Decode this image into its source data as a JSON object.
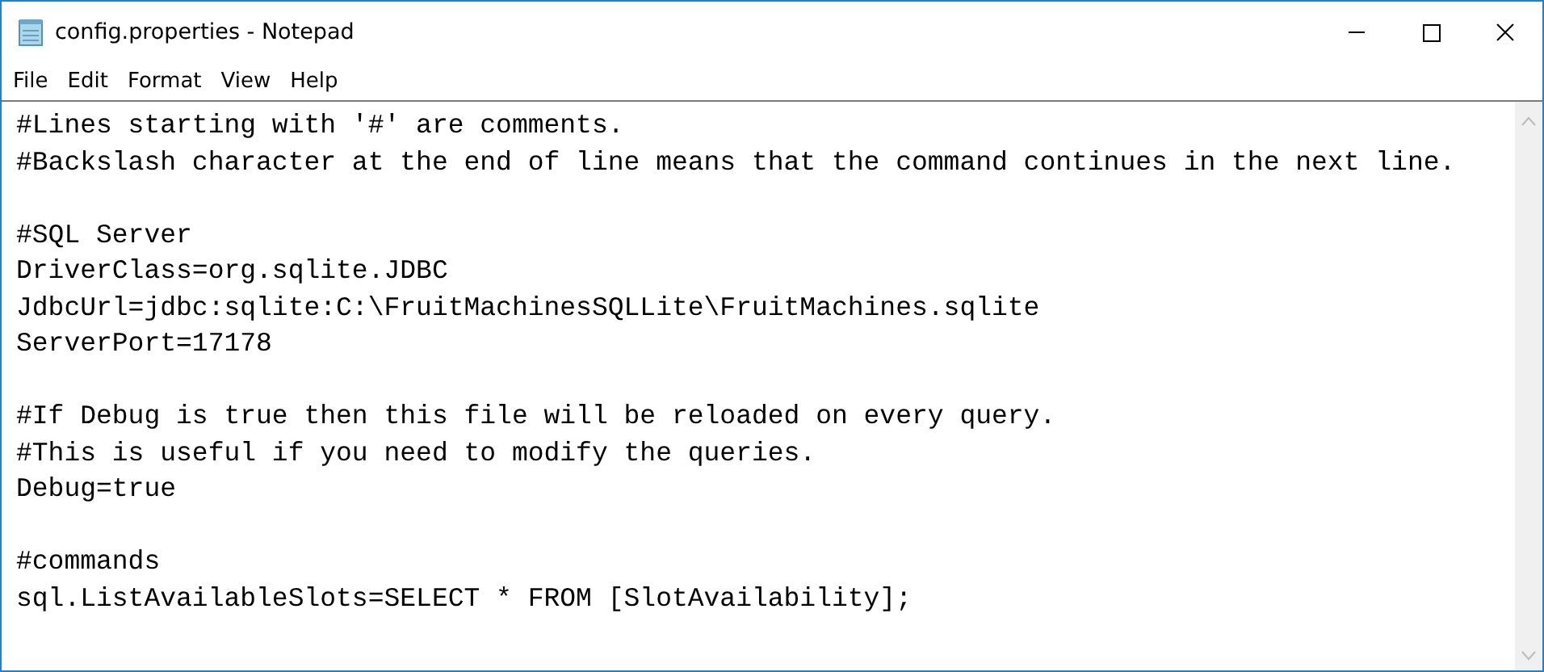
{
  "window": {
    "title": "config.properties - Notepad"
  },
  "menu": [
    "File",
    "Edit",
    "Format",
    "View",
    "Help"
  ],
  "editor": {
    "paragraphs": [
      [
        "#Lines starting with '#' are comments.",
        "#Backslash character at the end of line means that the command continues in the next line."
      ],
      [
        "#SQL Server",
        "DriverClass=org.sqlite.JDBC",
        "JdbcUrl=jdbc:sqlite:C:\\FruitMachinesSQLLite\\FruitMachines.sqlite",
        "ServerPort=17178"
      ],
      [
        "#If Debug is true then this file will be reloaded on every query.",
        "#This is useful if you need to modify the queries.",
        "Debug=true"
      ],
      [
        "#commands",
        "sql.ListAvailableSlots=SELECT * FROM [SlotAvailability];"
      ]
    ]
  }
}
